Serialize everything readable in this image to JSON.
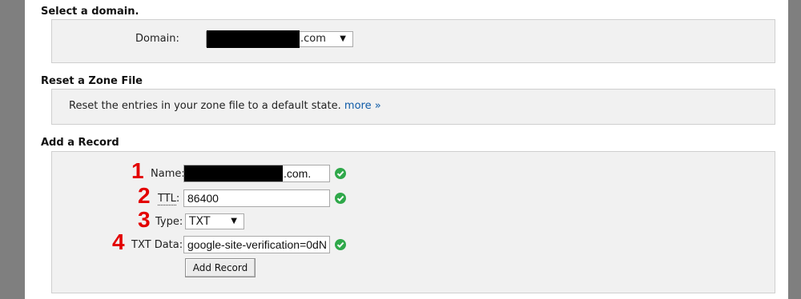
{
  "select_domain": {
    "title": "Select a domain.",
    "label": "Domain:",
    "value_suffix": ".com"
  },
  "reset_zone": {
    "title": "Reset a Zone File",
    "text": "Reset the entries in your zone file to a default state.",
    "link": "more »"
  },
  "add_record": {
    "title": "Add a Record",
    "annotations": [
      "1",
      "2",
      "3",
      "4"
    ],
    "name_label": "Name:",
    "name_suffix": ".com.",
    "ttl_label": "TTL",
    "ttl_colon": ":",
    "ttl_value": "86400",
    "type_label": "Type:",
    "type_value": "TXT",
    "txt_label": "TXT Data:",
    "txt_value": "google-site-verification=0dN",
    "button": "Add Record"
  },
  "colors": {
    "accent_red": "#e30000",
    "check_green": "#2fa84a",
    "link_blue": "#0d5aa7"
  }
}
